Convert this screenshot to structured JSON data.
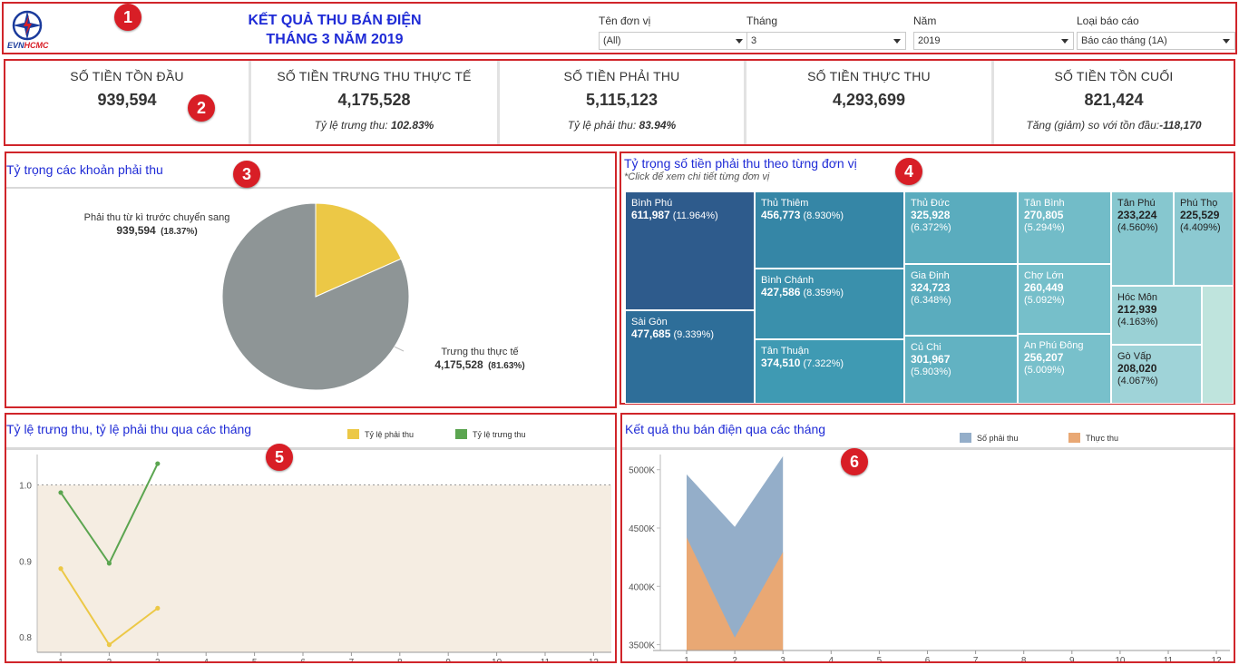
{
  "header": {
    "title_line1": "KẾT QUẢ THU BÁN ĐIỆN",
    "title_line2": "THÁNG 3 NĂM 2019",
    "logo_text_a": "EVN",
    "logo_text_b": "HCMC",
    "filters": [
      {
        "label": "Tên đơn vị",
        "value": "(All)"
      },
      {
        "label": "Tháng",
        "value": "3"
      },
      {
        "label": "Năm",
        "value": "2019"
      },
      {
        "label": "Loại báo cáo",
        "value": "Báo cáo tháng (1A)"
      }
    ]
  },
  "markers": [
    "1",
    "2",
    "3",
    "4",
    "5",
    "6"
  ],
  "kpis": [
    {
      "label": "SỐ TIỀN TỒN ĐẦU",
      "value": "939,594",
      "sub_label": "",
      "sub_value": ""
    },
    {
      "label": "SỐ TIỀN TRƯNG THU THỰC TẾ",
      "value": "4,175,528",
      "sub_label": "Tỷ lệ trưng thu: ",
      "sub_value": "102.83%"
    },
    {
      "label": "SỐ TIỀN PHẢI THU",
      "value": "5,115,123",
      "sub_label": "Tỷ lệ phải thu: ",
      "sub_value": "83.94%"
    },
    {
      "label": "SỐ TIỀN THỰC THU",
      "value": "4,293,699",
      "sub_label": "",
      "sub_value": ""
    },
    {
      "label": "SỐ TIỀN TỒN CUỐI",
      "value": "821,424",
      "sub_label": "Tăng (giảm) so với tồn đầu:",
      "sub_value": "-118,170"
    }
  ],
  "pie_panel": {
    "title": "Tỷ trọng các khoản phải thu"
  },
  "tree_panel": {
    "title": "Tỷ trọng số tiền phải thu theo từng đơn vị",
    "subtitle": "*Click để xem chi tiết từng đơn vị"
  },
  "rate_panel": {
    "title": "Tỷ lệ trưng thu, tỷ lệ phải thu qua các tháng"
  },
  "rev_panel": {
    "title": "Kết quả thu bán điện qua các tháng"
  },
  "chart_data": [
    {
      "type": "pie",
      "slices": [
        {
          "label": "Phải thu từ kì trước chuyển sang",
          "value": 939594,
          "value_text": "939,594",
          "pct_text": "(18.37%)",
          "color": "#ecc846"
        },
        {
          "label": "Trưng thu thực tế",
          "value": 4175528,
          "value_text": "4,175,528",
          "pct_text": "(81.63%)",
          "color": "#8e9596"
        }
      ]
    },
    {
      "type": "treemap",
      "cells": [
        {
          "name": "Bình Phú",
          "value": "611,987",
          "pct": "(11.964%)",
          "color": "#2e5b8c"
        },
        {
          "name": "Sài Gòn",
          "value": "477,685",
          "pct": "(9.339%)",
          "color": "#2e6e99"
        },
        {
          "name": "Thủ Thiêm",
          "value": "456,773",
          "pct": "(8.930%)",
          "color": "#3586a6"
        },
        {
          "name": "Bình Chánh",
          "value": "427,586",
          "pct": "(8.359%)",
          "color": "#3a90ac"
        },
        {
          "name": "Tân Thuận",
          "value": "374,510",
          "pct": "(7.322%)",
          "color": "#3f9ab3"
        },
        {
          "name": "Thủ Đức",
          "value": "325,928",
          "pct": "(6.372%)",
          "color": "#5aacbe"
        },
        {
          "name": "Gia Định",
          "value": "324,723",
          "pct": "(6.348%)",
          "color": "#5aacbe"
        },
        {
          "name": "Củ Chi",
          "value": "301,967",
          "pct": "(5.903%)",
          "color": "#62b2c2"
        },
        {
          "name": "Tân Bình",
          "value": "270,805",
          "pct": "(5.294%)",
          "color": "#72bcc8"
        },
        {
          "name": "Chợ Lớn",
          "value": "260,449",
          "pct": "(5.092%)",
          "color": "#76bfca"
        },
        {
          "name": "An Phú Đông",
          "value": "256,207",
          "pct": "(5.009%)",
          "color": "#78c0cb"
        },
        {
          "name": "Tân Phú",
          "value": "233,224",
          "pct": "(4.560%)",
          "color": "#86c7cf"
        },
        {
          "name": "Phú Thọ",
          "value": "225,529",
          "pct": "(4.409%)",
          "color": "#8cc9d1"
        },
        {
          "name": "Hóc Môn",
          "value": "212,939",
          "pct": "(4.163%)",
          "color": "#9ad1d5"
        },
        {
          "name": "Gò Vấp",
          "value": "208,020",
          "pct": "(4.067%)",
          "color": "#9fd3d8"
        },
        {
          "name": "",
          "value": "",
          "pct": "",
          "color": "#bfe4dd"
        }
      ]
    },
    {
      "type": "line",
      "x": [
        1,
        2,
        3
      ],
      "xticks": [
        "1",
        "2",
        "3",
        "4",
        "5",
        "6",
        "7",
        "8",
        "9",
        "10",
        "11",
        "12"
      ],
      "yticks": [
        "1.0",
        "0.9",
        "0.8"
      ],
      "ylim": [
        0.78,
        1.04
      ],
      "reference_line": 1.0,
      "series": [
        {
          "name": "Tỷ lệ phải thu",
          "color": "#ecc846",
          "values": [
            0.89,
            0.79,
            0.838
          ]
        },
        {
          "name": "Tỷ lệ trưng thu",
          "color": "#5ba550",
          "values": [
            0.99,
            0.897,
            1.028
          ]
        }
      ]
    },
    {
      "type": "area",
      "x": [
        1,
        2,
        3
      ],
      "xticks": [
        "1",
        "2",
        "3",
        "4",
        "5",
        "6",
        "7",
        "8",
        "9",
        "10",
        "11",
        "12"
      ],
      "yticks": [
        "5000K",
        "4500K",
        "4000K",
        "3500K"
      ],
      "ylim": [
        3450000,
        5130000
      ],
      "series": [
        {
          "name": "Số phải thu",
          "color": "#94aec9",
          "values": [
            4960000,
            4510000,
            5115123
          ]
        },
        {
          "name": "Thực thu",
          "color": "#e9a874",
          "values": [
            4420000,
            3560000,
            4293699
          ]
        }
      ]
    }
  ]
}
